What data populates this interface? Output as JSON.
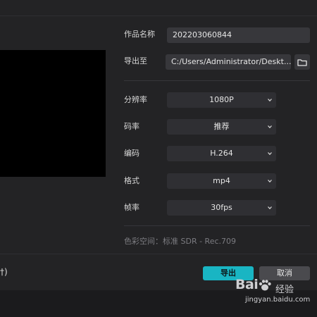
{
  "form": {
    "work_name_label": "作品名称",
    "work_name_value": "202203060844",
    "export_to_label": "导出至",
    "export_path": "C:/Users/Administrator/Deskt...",
    "resolution_label": "分辨率",
    "resolution_value": "1080P",
    "bitrate_label": "码率",
    "bitrate_value": "推荐",
    "codec_label": "编码",
    "codec_value": "H.264",
    "format_label": "格式",
    "format_value": "mp4",
    "framerate_label": "帧率",
    "framerate_value": "30fps",
    "color_space": "色彩空间：标准 SDR - Rec.709"
  },
  "footer": {
    "left_text": "†)",
    "export_button": "导出",
    "cancel_button": "取消"
  },
  "watermark": {
    "brand": "Bai",
    "brand_suffix": "经验",
    "url": "jingyan.baidu.com"
  },
  "icons": {
    "folder": "folder-icon",
    "chevron": "chevron-down-icon"
  },
  "colors": {
    "accent": "#19b5c3",
    "background": "#232325",
    "field": "#37373b"
  }
}
